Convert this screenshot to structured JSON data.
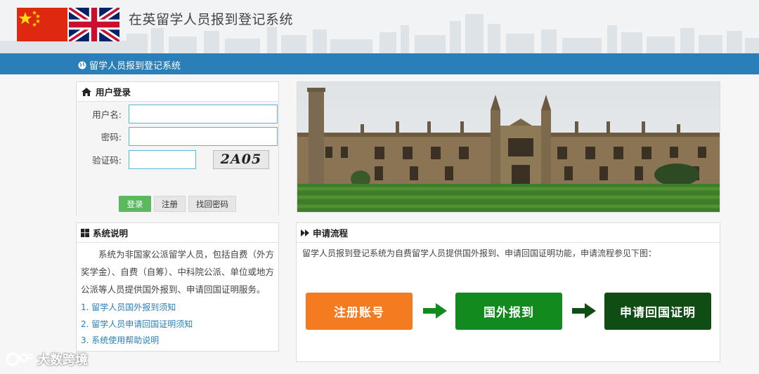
{
  "header": {
    "title": "在英留学人员报到登记系统",
    "flags": [
      "china-flag",
      "uk-flag"
    ]
  },
  "navbar": {
    "title": "留学人员报到登记系统",
    "icon": "globe-icon"
  },
  "login": {
    "heading": "用户登录",
    "icon": "home-icon",
    "username_label": "用户名:",
    "password_label": "密码:",
    "captcha_label": "验证码:",
    "username_value": "",
    "password_value": "",
    "captcha_value": "",
    "captcha_text": "2A05",
    "login_button": "登录",
    "register_button": "注册",
    "recover_button": "找回密码"
  },
  "info": {
    "heading": "系统说明",
    "icon": "windows-icon",
    "description": "系统为非国家公派留学人员，包括自费（外方奖学金）、自费（自筹）、中科院公派、单位或地方公派等人员提供国外报到、申请回国证明服务。",
    "links": [
      "1. 留学人员国外报到须知",
      "2. 留学人员申请回国证明须知",
      "3. 系统使用帮助说明"
    ]
  },
  "flow": {
    "heading": "申请流程",
    "icon": "play-forward-icon",
    "description": "留学人员报到登记系统为自费留学人员提供国外报到、申请回国证明功能，申请流程参见下图：",
    "steps": [
      "注册账号",
      "国外报到",
      "申请回国证明"
    ],
    "step_colors": [
      "#f47b20",
      "#138a1e",
      "#0f4d14"
    ]
  },
  "colors": {
    "nav": "#2a7fb8",
    "accent_green": "#5cb85c",
    "link": "#2a7fb8"
  },
  "watermark": "大数跨境"
}
